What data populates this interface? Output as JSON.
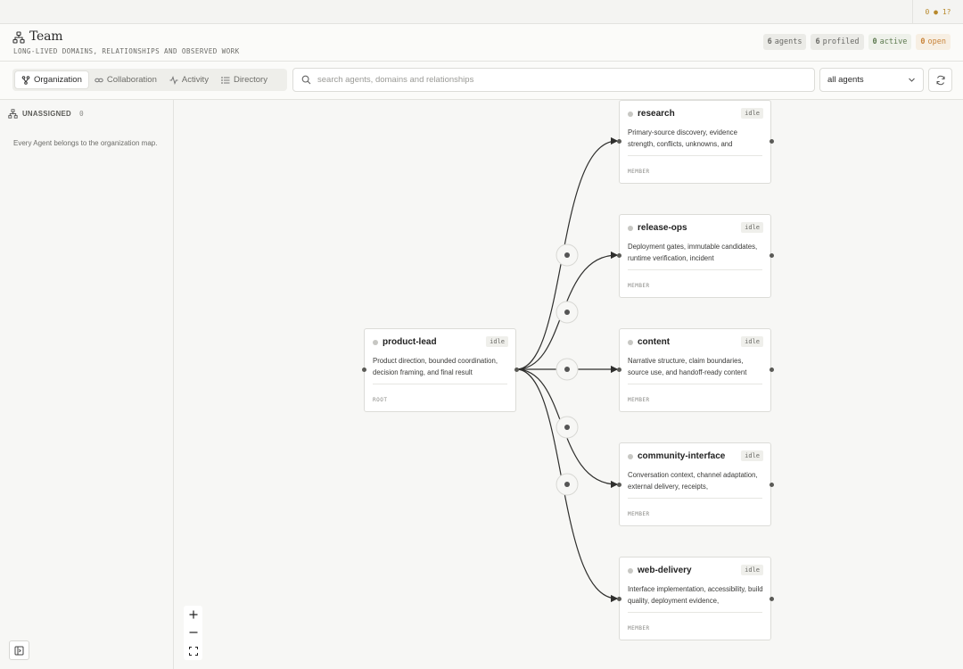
{
  "version_label": "0 ● 1?",
  "header": {
    "title": "Team",
    "subtitle": "LONG-LIVED DOMAINS, RELATIONSHIPS AND OBSERVED WORK",
    "badges": {
      "agents": {
        "count": "6",
        "label": "agents"
      },
      "profiled": {
        "count": "6",
        "label": "profiled"
      },
      "active": {
        "count": "0",
        "label": "active"
      },
      "open": {
        "count": "0",
        "label": "open"
      }
    }
  },
  "toolbar": {
    "tabs": [
      {
        "label": "Organization",
        "icon": "hierarchy-icon"
      },
      {
        "label": "Collaboration",
        "icon": "link-icon"
      },
      {
        "label": "Activity",
        "icon": "pulse-icon"
      },
      {
        "label": "Directory",
        "icon": "list-icon"
      }
    ],
    "search_placeholder": "search agents, domains and relationships",
    "search_value": "",
    "filter_value": "all agents"
  },
  "sidebar": {
    "unassigned_label": "UNASSIGNED",
    "unassigned_count": "0",
    "note": "Every Agent belongs to the organization map."
  },
  "nodes": [
    {
      "id": "product-lead",
      "name": "product-lead",
      "state": "idle",
      "description": "Product direction, bounded coordination, decision framing, and final result",
      "role": "ROOT"
    },
    {
      "id": "research",
      "name": "research",
      "state": "idle",
      "description": "Primary-source discovery, evidence strength, conflicts, unknowns, and",
      "role": "MEMBER"
    },
    {
      "id": "release-ops",
      "name": "release-ops",
      "state": "idle",
      "description": "Deployment gates, immutable candidates, runtime verification, incident",
      "role": "MEMBER"
    },
    {
      "id": "content",
      "name": "content",
      "state": "idle",
      "description": "Narrative structure, claim boundaries, source use, and handoff-ready content",
      "role": "MEMBER"
    },
    {
      "id": "community-interface",
      "name": "community-interface",
      "state": "idle",
      "description": "Conversation context, channel adaptation, external delivery, receipts,",
      "role": "MEMBER"
    },
    {
      "id": "web-delivery",
      "name": "web-delivery",
      "state": "idle",
      "description": "Interface implementation, accessibility, build quality, deployment evidence,",
      "role": "MEMBER"
    }
  ],
  "colors": {
    "accent_active": "#5d7a50",
    "accent_open": "#c9843a",
    "edge": "#2f2f2d"
  }
}
